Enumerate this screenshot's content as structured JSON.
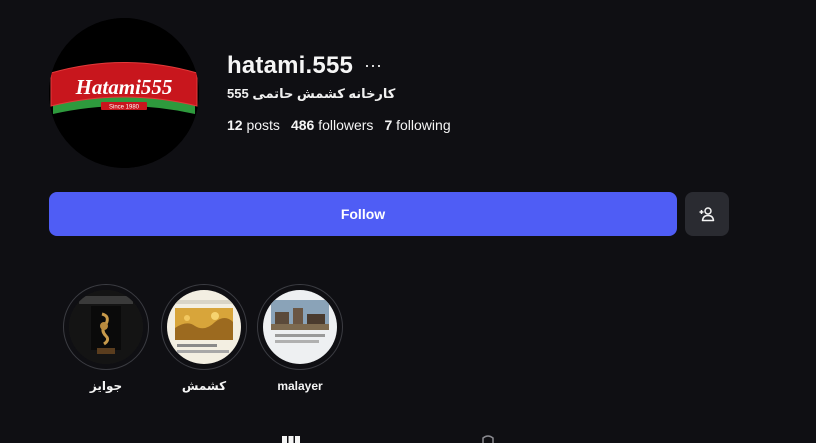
{
  "profile": {
    "username": "hatami.555",
    "bio": "کارخانه کشمش حاتمی 555",
    "logo_text": "Hatami555",
    "logo_subtext": "Since 1980",
    "more_icon": "ellipsis-icon"
  },
  "stats": {
    "posts_count": "12",
    "posts_label": "posts",
    "followers_count": "486",
    "followers_label": "followers",
    "following_count": "7",
    "following_label": "following"
  },
  "actions": {
    "follow_label": "Follow",
    "suggest_icon": "add-person-icon"
  },
  "highlights": [
    {
      "label": "جوایز"
    },
    {
      "label": "کشمش"
    },
    {
      "label": "malayer"
    }
  ],
  "colors": {
    "background": "#0f0f13",
    "follow_button": "#4f5df5",
    "secondary_button": "#2a2b31",
    "logo_red": "#c8161d",
    "logo_green": "#2e9a3d"
  }
}
